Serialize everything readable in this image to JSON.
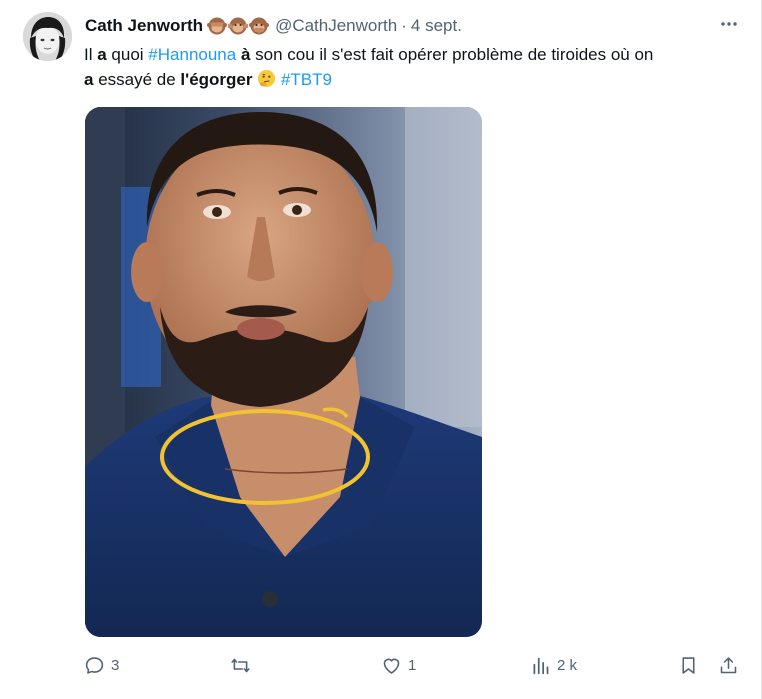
{
  "author": {
    "display_name": "Cath Jenworth",
    "handle": "@CathJenworth",
    "separator": "·",
    "date": "4 sept."
  },
  "tweet": {
    "t1": "Il ",
    "t2": "a",
    "t3": " quoi ",
    "tag1": "#Hannouna",
    "t4": " ",
    "t5": "à",
    "t6": " son cou il s'est fait opérer problème de tiroides où on",
    "t7": "a",
    "t8": " essayé de ",
    "t9": "l'égorger",
    "t10": " ",
    "tag2": "#TBT9"
  },
  "actions": {
    "replies": "3",
    "retweets": "",
    "likes": "1",
    "views": "2 k"
  },
  "icons": {
    "more": "more-dots-icon",
    "reply": "reply-icon",
    "retweet": "retweet-icon",
    "like": "heart-icon",
    "views": "views-icon",
    "bookmark": "bookmark-icon",
    "share": "share-icon"
  },
  "colors": {
    "text": "#0f1419",
    "secondary": "#536471",
    "link": "#1d9bf0",
    "annotation_circle": "#f2c230"
  }
}
